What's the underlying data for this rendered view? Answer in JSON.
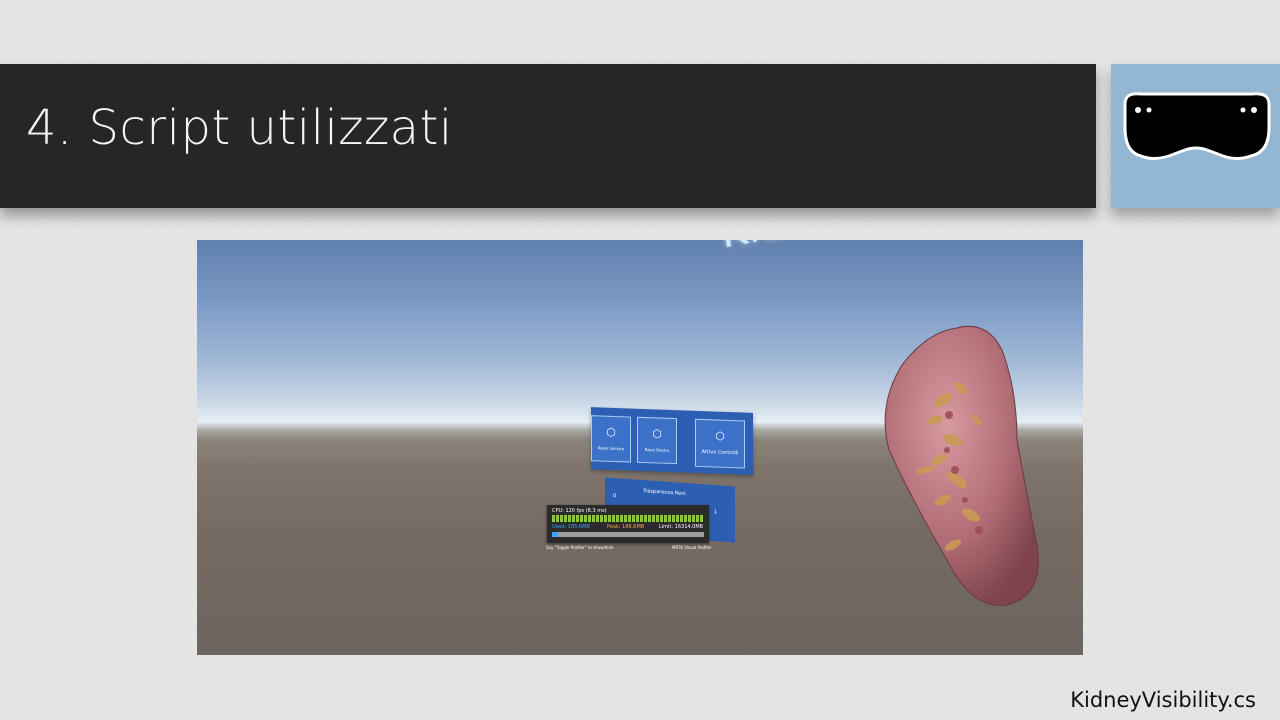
{
  "slide": {
    "title": "4. Script utilizzati",
    "caption": "KidneyVisibility.cs",
    "logo_icon": "hololens-headset-icon",
    "colors": {
      "title_bar": "#262626",
      "logo_bg": "#93b6d3"
    }
  },
  "scene": {
    "watermark": "KidneyViewe",
    "menu_buttons": [
      {
        "label": "Rene Sinistro",
        "icon": "cube-icon"
      },
      {
        "label": "Rene Destro",
        "icon": "cube-icon"
      },
      {
        "label": "Attiva Controlli",
        "icon": "cube-icon"
      }
    ],
    "transparency_panel": {
      "title": "Trasparenza Reni",
      "min": "0",
      "max": "1"
    },
    "profiler": {
      "cpu": "CPU: 120 fps (8.3 ms)",
      "used": "Used: 185.6MB",
      "peak": "Peak: 186.6MB",
      "limit": "Limit: 16314.0MB",
      "memory_used_fraction": 0.04
    },
    "hint_left": "Say \"Toggle Profiler\" to show/hide",
    "hint_right": "MRTK Visual Profiler"
  }
}
